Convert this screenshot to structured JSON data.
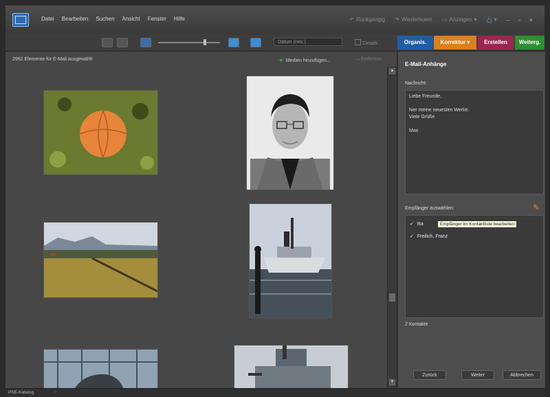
{
  "menubar": {
    "menu_items": [
      "Datei",
      "Bearbeiten",
      "Suchen",
      "Ansicht",
      "Fenster",
      "Hilfe"
    ],
    "undo_label": "Rückgängig",
    "redo_label": "Wiederholen",
    "display_label": "Anzeigen",
    "home_icon": "home-icon",
    "window_controls": "– ▫ ×"
  },
  "toolbar": {
    "sort_select_value": "Datum (neu.)",
    "details_label": "Details",
    "tabs": {
      "organize": "Organis.",
      "fix": "Korrektur",
      "create": "Erstellen",
      "share": "Weiterg."
    },
    "colors": {
      "organize": "#205da6",
      "fix": "#dd7f1f",
      "create": "#9b2653",
      "share": "#2e8f33"
    }
  },
  "media": {
    "header": "2952 Elemente für E-Mail ausgewählt",
    "add_media_label": "Medien hinzufügen...",
    "remove_label": "Entfernen",
    "thumbnails": [
      "basketball-on-grass",
      "portrait-man-glasses",
      "field-landscape",
      "steamboat-harbor",
      "glass-building-car",
      "ship-partial"
    ]
  },
  "panel": {
    "title": "E-Mail-Anhänge",
    "message_label": "Nachricht:",
    "message_lines": [
      "Liebe Freunde,",
      "",
      "hier meine neuesten Werke.",
      "Viele Grüße",
      "",
      "Max"
    ],
    "recipients_label": "Empfänger auswählen:",
    "recipients": [
      {
        "name": "Ra",
        "checked": true
      },
      {
        "name": "Freilich, Franz",
        "checked": true
      }
    ],
    "tooltip": "Empfänger im Kontaktliste bearbeiten",
    "contact_count": "2 Kontakte",
    "buttons": {
      "back": "Zurück",
      "next": "Weiter",
      "cancel": "Abbrechen"
    }
  },
  "statusbar": {
    "catalog": "PSE-Katalog"
  }
}
